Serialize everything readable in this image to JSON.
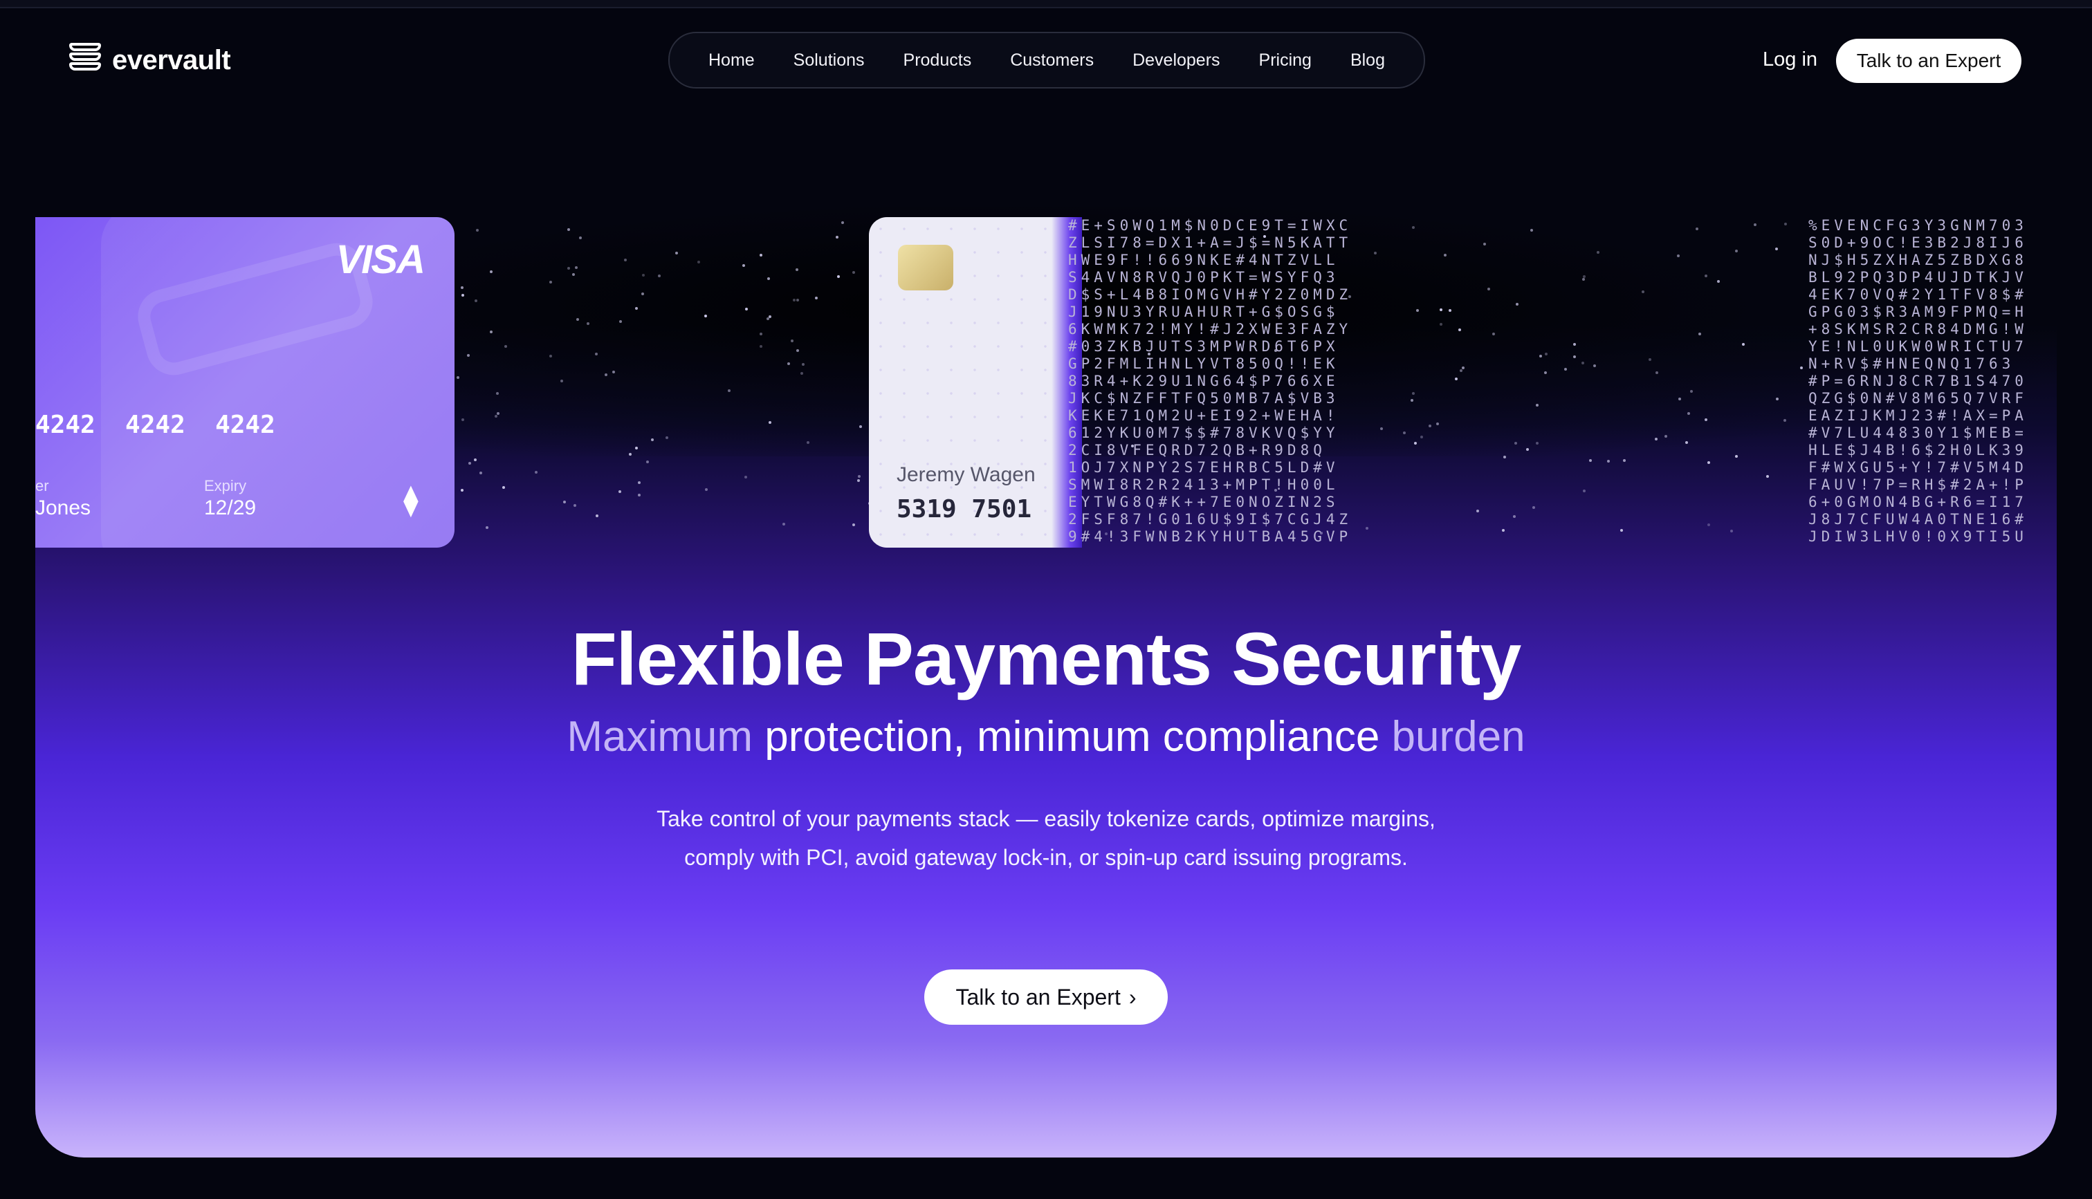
{
  "brand": {
    "name": "evervault",
    "logo_icon": "evervault-logo-icon"
  },
  "nav": {
    "items": [
      "Home",
      "Solutions",
      "Products",
      "Customers",
      "Developers",
      "Pricing",
      "Blog"
    ],
    "login": "Log in",
    "cta": "Talk to an Expert"
  },
  "cards": {
    "left": {
      "brand": "VISA",
      "number": "4242  4242  4242",
      "holder_label": "er",
      "holder_name": "Jones",
      "expiry_label": "Expiry",
      "expiry": "12/29",
      "contactless_icon": "contactless-icon"
    },
    "middle": {
      "holder_name": "Jeremy Wagen",
      "number": "5319 7501"
    }
  },
  "encrypted_text": {
    "middle": "#E+S0WQ1M$N0DCE9T=IWXC\nZLSI78=DX1+A=J$=N5KATT\nHWE9F!!669NKE#4NTZVLL\nS4AVN8RVQJ0PKT=WSYFQ3\nD$S+L4B8IOMGVH#Y2Z0MDZ\nJ19NU3YRUAHURT+G$OSG$\n6KWMK72!MY!#J2XWE3FAZY\n#03ZKBJUTS3MPWRD6T6PX\nGP2FMLIHNLYVT850Q!!EK\n83R4+K29U1NG64$P766XE\nJKC$NZFFTFQ50MB7A$VB3\nKEKE71QM2U+EI92+WEHA!\n612YKU0M7$$#78VKVQ$YY\n2CI8VFEQRD72QB+R9D8Q\n1OJ7XNPY2S7EHRBC5LD#V\nSMWI8R2R2413+MPT!H00L\nEYTWG8Q#K++7E0NOZIN2S\n2FSF87!G016U$9I$7CGJ4Z\n9#4!3FWNB2KYHUTBA45GVP",
    "right": "%EVENCFG3Y3GNM703\nS0D+9OC!E3B2J8IJ6\nNJ$H5ZXHAZ5ZBDXG8\nBL92PQ3DP4UJDTKJV\n4EK70VQ#2Y1TFV8$#\nGPG03$R3AM9FPMQ=H\n+8SKMSR2CR84DMG!W\nYE!NL0UKW0WRICTU7\nN+RV$#HNEQNQ1763\n#P=6RNJ8CR7B1S470\nQZG$0N#V8M65Q7VRF\nEAZIJKMJ23#!AX=PA\n#V7LU44830Y1$MEB=\nHLE$J4B!6$2H0LK39\nF#WXGU5+Y!7#V5M4D\nFAUV!7P=RH$#2A+!P\n6+0GMON4BG+R6=I17\nJ8J7CFUW4A0TNE16#\nJDIW3LHV0!0X9TI5U"
  },
  "hero": {
    "title": "Flexible Payments Security",
    "subtitle_part1": "Maximum",
    "subtitle_part2": "protection, minimum compliance",
    "subtitle_part3": "burden",
    "description": "Take control of your payments stack — easily tokenize cards, optimize margins, comply with PCI, avoid gateway lock-in, or spin-up card issuing programs.",
    "cta": "Talk to an Expert",
    "cta_icon": "chevron-right-icon"
  },
  "colors": {
    "background": "#04050f",
    "accent": "#6a3cf3",
    "card_purple": "#8f70f2"
  }
}
